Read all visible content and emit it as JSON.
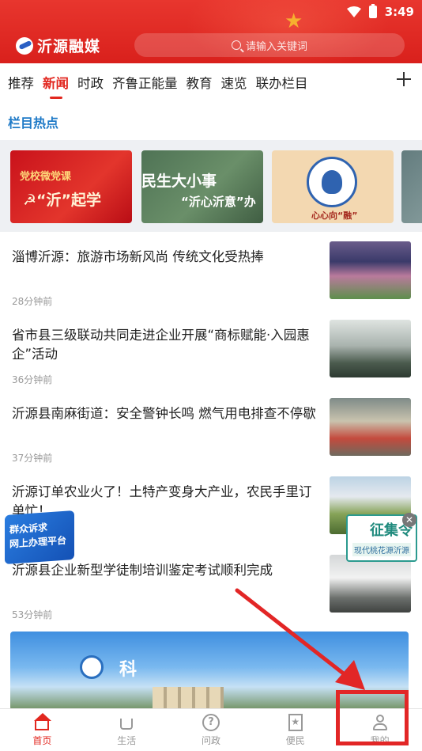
{
  "status_bar": {
    "time": "3:49"
  },
  "header": {
    "app_name": "沂源融媒",
    "search_placeholder": "请输入关键词"
  },
  "tabs": [
    {
      "label": "推荐",
      "active": false
    },
    {
      "label": "新闻",
      "active": true
    },
    {
      "label": "时政",
      "active": false
    },
    {
      "label": "齐鲁正能量",
      "active": false
    },
    {
      "label": "教育",
      "active": false
    },
    {
      "label": "速览",
      "active": false
    },
    {
      "label": "联办栏目",
      "active": false
    }
  ],
  "hot_section": {
    "title": "栏目热点",
    "cards": [
      {
        "line1": "党校微党课",
        "line2": "☭“沂”起学"
      },
      {
        "line1": "民生大小事",
        "line2": "“沂心沂意”办"
      },
      {
        "line1": "心心向“融”"
      },
      {
        "line1": ""
      }
    ]
  },
  "news": [
    {
      "title": "淄博沂源：旅游市场新风尚 传统文化受热捧",
      "time": "28分钟前"
    },
    {
      "title": "省市县三级联动共同走进企业开展“商标赋能·入园惠企”活动",
      "time": "36分钟前"
    },
    {
      "title": "沂源县南麻街道：安全警钟长鸣 燃气用电排查不停歇",
      "time": "37分钟前"
    },
    {
      "title": "沂源订单农业火了！土特产变身大产业，农民手里订单忙！",
      "time": ""
    },
    {
      "title": "沂源县企业新型学徒制培训鉴定考试顺利完成",
      "time": "53分钟前"
    }
  ],
  "banner": {
    "text": "科"
  },
  "float_left": {
    "line1": "群众诉求",
    "line2": "网上办理平台"
  },
  "float_right": {
    "line1": "征集令",
    "line2": "现代桃花源沂源"
  },
  "bottom_nav": [
    {
      "label": "首页",
      "active": true,
      "icon": "home-icon"
    },
    {
      "label": "生活",
      "active": false,
      "icon": "cup-icon"
    },
    {
      "label": "问政",
      "active": false,
      "icon": "question-icon"
    },
    {
      "label": "便民",
      "active": false,
      "icon": "star-icon"
    },
    {
      "label": "我的",
      "active": false,
      "icon": "user-icon"
    }
  ],
  "colors": {
    "brand_red": "#e2271f",
    "section_blue": "#1f7ac7",
    "annotation_red": "#e22626"
  }
}
